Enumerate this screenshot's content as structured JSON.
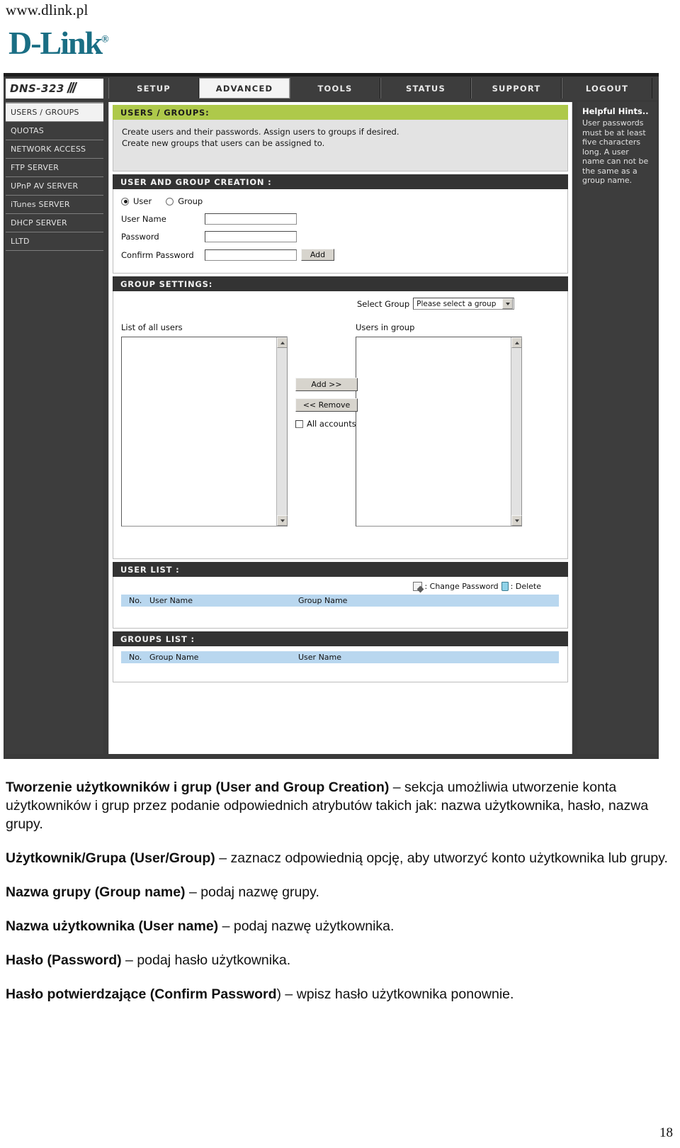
{
  "header": {
    "url": "www.dlink.pl",
    "logo_text": "D-Link",
    "logo_reg": "®"
  },
  "device": {
    "model": "DNS-323"
  },
  "nav": {
    "tabs": [
      {
        "label": "SETUP",
        "active": false
      },
      {
        "label": "ADVANCED",
        "active": true
      },
      {
        "label": "TOOLS",
        "active": false
      },
      {
        "label": "STATUS",
        "active": false
      },
      {
        "label": "SUPPORT",
        "active": false
      },
      {
        "label": "LOGOUT",
        "active": false
      }
    ]
  },
  "sidebar": {
    "items": [
      {
        "label": "USERS / GROUPS",
        "active": true
      },
      {
        "label": "QUOTAS",
        "active": false
      },
      {
        "label": "NETWORK ACCESS",
        "active": false
      },
      {
        "label": "FTP SERVER",
        "active": false
      },
      {
        "label": "UPnP AV SERVER",
        "active": false
      },
      {
        "label": "iTunes SERVER",
        "active": false
      },
      {
        "label": "DHCP SERVER",
        "active": false
      },
      {
        "label": "LLTD",
        "active": false
      }
    ]
  },
  "users_groups": {
    "title": "USERS / GROUPS:",
    "intro_line1": "Create users and their passwords. Assign users to groups if desired.",
    "intro_line2": "Create new groups that users can be assigned to."
  },
  "creation": {
    "title": "USER AND GROUP CREATION :",
    "radio_user": "User",
    "radio_group": "Group",
    "user_name_label": "User Name",
    "user_name_value": "",
    "password_label": "Password",
    "password_value": "",
    "confirm_label": "Confirm Password",
    "confirm_value": "",
    "add_button": "Add"
  },
  "group_settings": {
    "title": "GROUP SETTINGS:",
    "select_group_label": "Select Group",
    "select_group_value": "Please select a group",
    "list_all_users_label": "List of all users",
    "users_in_group_label": "Users in group",
    "add_button": "Add >>",
    "remove_button": "<< Remove",
    "all_accounts_label": "All accounts",
    "all_accounts_checked": false
  },
  "user_list": {
    "title": "USER LIST :",
    "legend_change_password": ": Change Password",
    "legend_delete": ": Delete",
    "columns": [
      "No.",
      "User Name",
      "Group Name"
    ],
    "rows": []
  },
  "groups_list": {
    "title": "GROUPS LIST :",
    "columns": [
      "No.",
      "Group Name",
      "User Name"
    ],
    "rows": []
  },
  "hints": {
    "title": "Helpful Hints..",
    "text": "User passwords must be at least five characters long. A user name can not be the same as a group name."
  },
  "doc": {
    "paragraphs": [
      {
        "bold": "Tworzenie użytkowników i grup (User and Group Creation)",
        "rest": " – sekcja umożliwia utworzenie konta użytkowników i grup przez podanie odpowiednich atrybutów takich jak: nazwa użytkownika, hasło, nazwa grupy."
      },
      {
        "bold": "Użytkownik/Grupa (User/Group)",
        "rest": " – zaznacz odpowiednią opcję, aby utworzyć konto użytkownika lub grupy."
      },
      {
        "bold": "Nazwa grupy (Group name)",
        "rest": " – podaj nazwę grupy."
      },
      {
        "bold": "Nazwa użytkownika (User name)",
        "rest": " – podaj nazwę użytkownika."
      },
      {
        "bold": "Hasło (Password)",
        "rest": " – podaj hasło użytkownika."
      },
      {
        "bold": "Hasło potwierdzające (Confirm Password",
        "rest": ") – wpisz hasło użytkownika ponownie."
      }
    ],
    "page_number": "18"
  },
  "colors": {
    "brand_teal": "#1a6e84",
    "accent_green": "#aec94a",
    "dark_panel": "#333333",
    "table_header_blue": "#b9d7ef"
  }
}
